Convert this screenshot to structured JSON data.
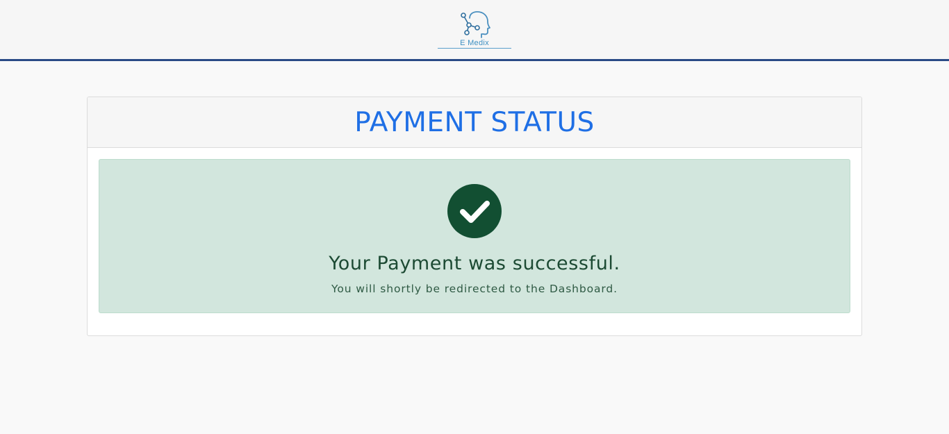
{
  "header": {
    "logo_text": "E Medix",
    "logo_icon": "head-network-icon",
    "border_color": "#2a4a86"
  },
  "card": {
    "title": "PAYMENT STATUS",
    "title_color": "#1f6fe5"
  },
  "alert": {
    "icon": "check-circle-icon",
    "icon_color": "#124f32",
    "background": "#d2e6dd",
    "message": "Your Payment was successful.",
    "submessage": "You will shortly be redirected to the Dashboard."
  }
}
